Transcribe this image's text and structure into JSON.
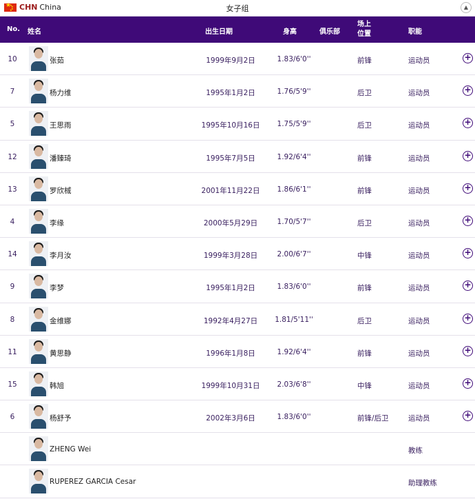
{
  "topbar": {
    "country_code": "CHN",
    "country_name": "China",
    "group_title": "女子组",
    "collapse_icon": "chevron-up-icon"
  },
  "header": {
    "no": "No.",
    "name": "姓名",
    "birth": "出生日期",
    "height": "身高",
    "club": "俱乐部",
    "position_line1": "场上",
    "position_line2": "位置",
    "role": "职能"
  },
  "colors": {
    "header_bg": "#3f0a78",
    "flag_red": "#de2910",
    "flag_star": "#ffde00"
  },
  "rows": [
    {
      "no": "10",
      "name": "张茹",
      "birth": "1999年9月2日",
      "height": "1.83/6'0''",
      "position": "前锋",
      "role": "运动员",
      "expand": true
    },
    {
      "no": "7",
      "name": "杨力维",
      "birth": "1995年1月2日",
      "height": "1.76/5'9''",
      "position": "后卫",
      "role": "运动员",
      "expand": true
    },
    {
      "no": "5",
      "name": "王思雨",
      "birth": "1995年10月16日",
      "height": "1.75/5'9''",
      "position": "后卫",
      "role": "运动员",
      "expand": true
    },
    {
      "no": "12",
      "name": "潘臻琦",
      "birth": "1995年7月5日",
      "height": "1.92/6'4''",
      "position": "前锋",
      "role": "运动员",
      "expand": true
    },
    {
      "no": "13",
      "name": "罗欣棫",
      "birth": "2001年11月22日",
      "height": "1.86/6'1''",
      "position": "前锋",
      "role": "运动员",
      "expand": true
    },
    {
      "no": "4",
      "name": "李缘",
      "birth": "2000年5月29日",
      "height": "1.70/5'7''",
      "position": "后卫",
      "role": "运动员",
      "expand": true
    },
    {
      "no": "14",
      "name": "李月汝",
      "birth": "1999年3月28日",
      "height": "2.00/6'7''",
      "position": "中锋",
      "role": "运动员",
      "expand": true
    },
    {
      "no": "9",
      "name": "李梦",
      "birth": "1995年1月2日",
      "height": "1.83/6'0''",
      "position": "前锋",
      "role": "运动员",
      "expand": true
    },
    {
      "no": "8",
      "name": "金维娜",
      "birth": "1992年4月27日",
      "height": "1.81/5'11''",
      "position": "后卫",
      "role": "运动员",
      "expand": true
    },
    {
      "no": "11",
      "name": "黄思静",
      "birth": "1996年1月8日",
      "height": "1.92/6'4''",
      "position": "前锋",
      "role": "运动员",
      "expand": true
    },
    {
      "no": "15",
      "name": "韩旭",
      "birth": "1999年10月31日",
      "height": "2.03/6'8''",
      "position": "中锋",
      "role": "运动员",
      "expand": true
    },
    {
      "no": "6",
      "name": "杨舒予",
      "birth": "2002年3月6日",
      "height": "1.83/6'0''",
      "position": "前锋/后卫",
      "role": "运动员",
      "expand": true
    },
    {
      "no": "",
      "name": "ZHENG Wei",
      "birth": "",
      "height": "",
      "position": "",
      "role": "教练",
      "expand": false
    },
    {
      "no": "",
      "name": "RUPEREZ GARCIA Cesar",
      "birth": "",
      "height": "",
      "position": "",
      "role": "助理教练",
      "expand": false
    }
  ]
}
